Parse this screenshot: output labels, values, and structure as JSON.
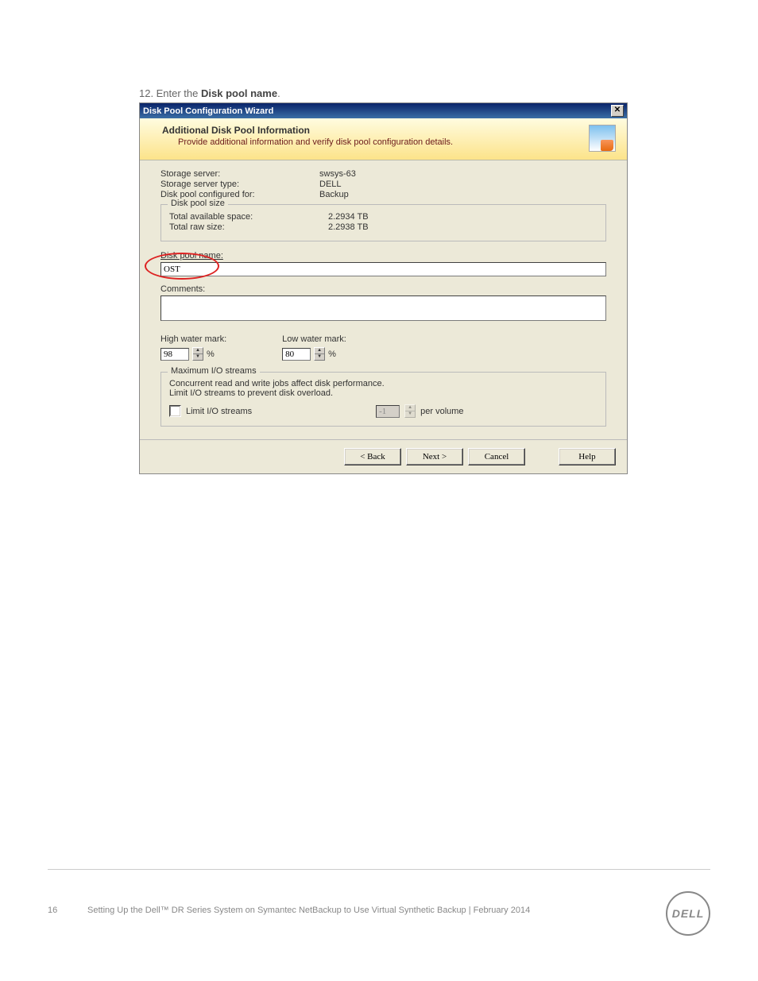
{
  "step": {
    "number": "12.",
    "text_prefix": "Enter the ",
    "text_bold": "Disk pool name",
    "text_suffix": "."
  },
  "wizard": {
    "title": "Disk Pool Configuration Wizard",
    "banner": {
      "title": "Additional Disk Pool Information",
      "subtitle": "Provide additional information and verify disk pool configuration details."
    },
    "info": {
      "storage_server_label": "Storage server:",
      "storage_server_value": "swsys-63",
      "storage_type_label": "Storage server type:",
      "storage_type_value": "DELL",
      "configured_for_label": "Disk pool configured for:",
      "configured_for_value": "Backup"
    },
    "size_group": {
      "legend": "Disk pool size",
      "available_label": "Total available space:",
      "available_value": "2.2934 TB",
      "raw_label": "Total raw size:",
      "raw_value": "2.2938 TB"
    },
    "name": {
      "label": "Disk pool name:",
      "value": "OST"
    },
    "comments": {
      "label": "Comments:",
      "value": ""
    },
    "high_mark": {
      "label": "High water mark:",
      "value": "98",
      "unit": "%"
    },
    "low_mark": {
      "label": "Low water mark:",
      "value": "80",
      "unit": "%"
    },
    "io_group": {
      "legend": "Maximum I/O streams",
      "desc": "Concurrent read and write jobs affect disk performance.\nLimit I/O streams to prevent disk overload.",
      "chk_label": "Limit I/O streams",
      "value": "-1",
      "unit": "per volume"
    },
    "buttons": {
      "back": "< Back",
      "next": "Next >",
      "cancel": "Cancel",
      "help": "Help"
    }
  },
  "footer": {
    "page": "16",
    "text": "Setting Up the Dell™ DR Series System on Symantec NetBackup to Use Virtual Synthetic Backup | February 2014"
  },
  "logo": "DELL"
}
